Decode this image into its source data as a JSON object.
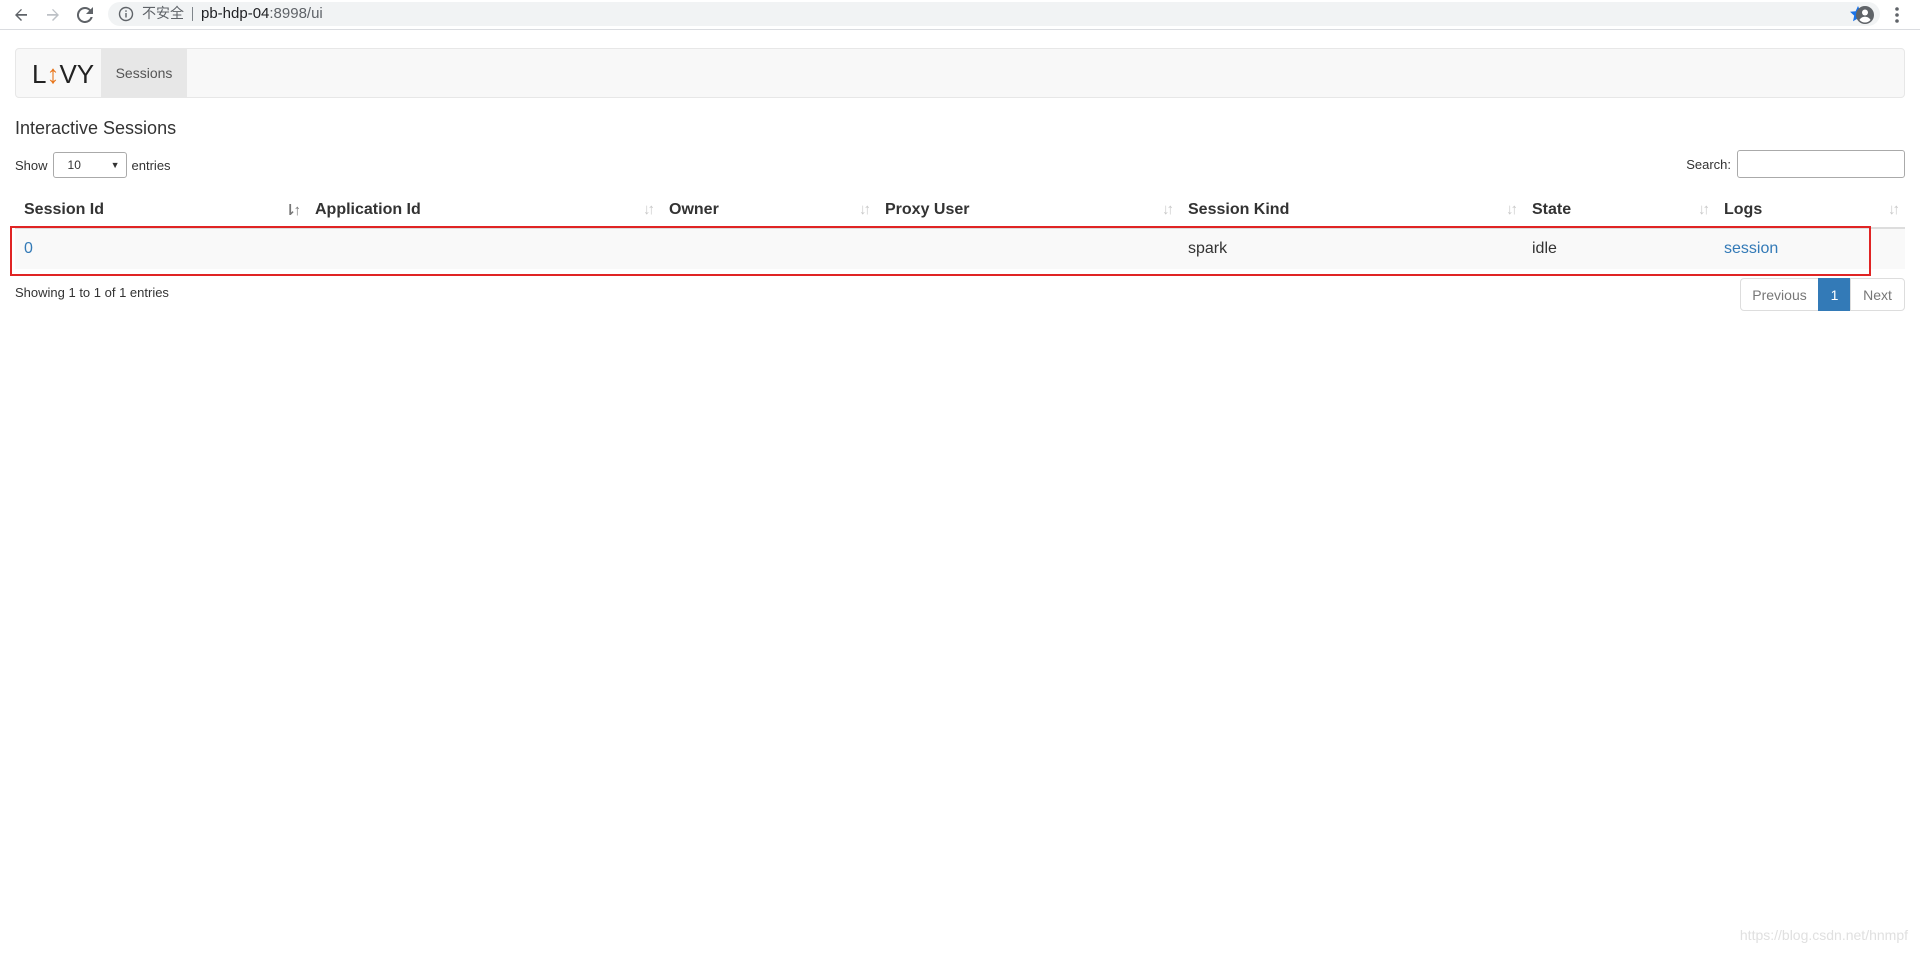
{
  "browser": {
    "insecure_label": "不安全",
    "url_host": "pb-hdp-04",
    "url_rest": ":8998/ui"
  },
  "navbar": {
    "brand_prefix": "L",
    "brand_arrow": "↕",
    "brand_suffix": "VY",
    "tab_sessions": "Sessions"
  },
  "section": {
    "title": "Interactive Sessions"
  },
  "length_control": {
    "show_label": "Show",
    "selected": "10",
    "entries_label": "entries"
  },
  "search": {
    "label": "Search:",
    "value": ""
  },
  "table": {
    "columns": [
      {
        "label": "Session Id"
      },
      {
        "label": "Application Id"
      },
      {
        "label": "Owner"
      },
      {
        "label": "Proxy User"
      },
      {
        "label": "Session Kind"
      },
      {
        "label": "State"
      },
      {
        "label": "Logs"
      }
    ],
    "rows": [
      {
        "session_id": "0",
        "application_id": "",
        "owner": "",
        "proxy_user": "",
        "session_kind": "spark",
        "state": "idle",
        "logs": "session"
      }
    ]
  },
  "info": {
    "text": "Showing 1 to 1 of 1 entries"
  },
  "pagination": {
    "previous": "Previous",
    "current": "1",
    "next": "Next"
  },
  "watermark": {
    "text": "https://blog.csdn.net/hnmpf"
  },
  "colors": {
    "link": "#337ab7",
    "highlight": "#e02424",
    "brand_arrow": "#e8751a"
  }
}
